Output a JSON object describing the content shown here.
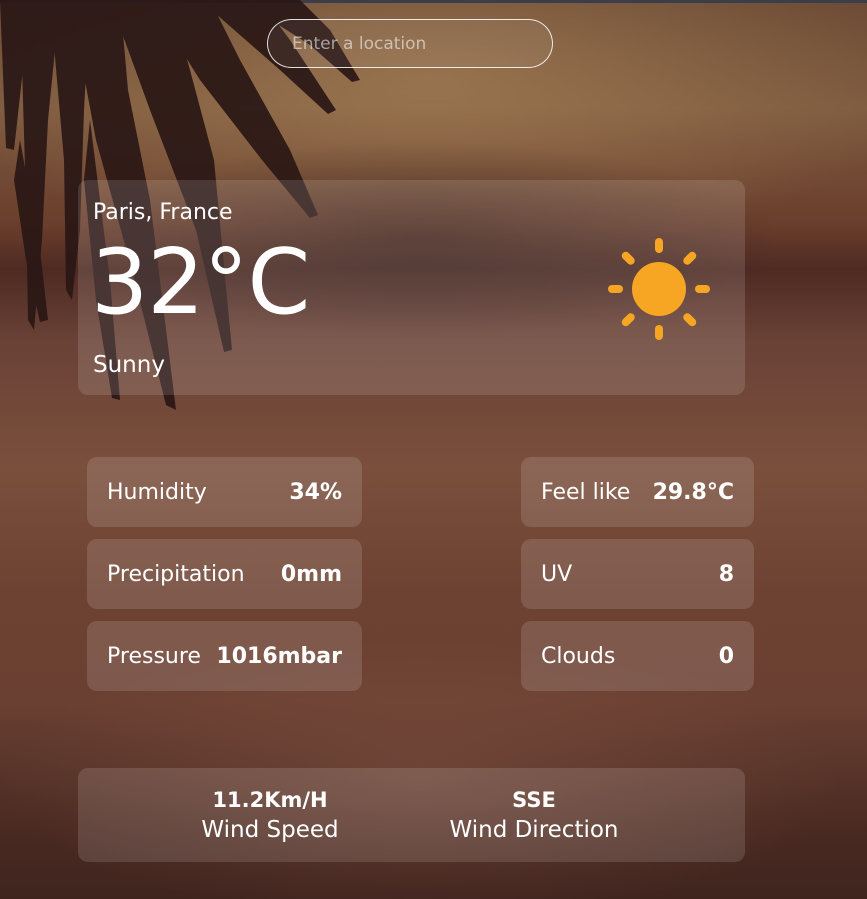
{
  "search": {
    "placeholder": "Enter a location",
    "value": ""
  },
  "current": {
    "location": "Paris, France",
    "temperature": "32°C",
    "condition": "Sunny",
    "icon": "sun-icon",
    "icon_color": "#f6a623"
  },
  "stats_left": [
    {
      "label": "Humidity",
      "value": "34%"
    },
    {
      "label": "Precipitation",
      "value": "0mm"
    },
    {
      "label": "Pressure",
      "value": "1016mbar"
    }
  ],
  "stats_right": [
    {
      "label": "Feel like",
      "value": "29.8°C"
    },
    {
      "label": "UV",
      "value": "8"
    },
    {
      "label": "Clouds",
      "value": "0"
    }
  ],
  "wind": {
    "speed_value": "11.2Km/H",
    "speed_label": "Wind Speed",
    "direction_value": "SSE",
    "direction_label": "Wind Direction"
  }
}
